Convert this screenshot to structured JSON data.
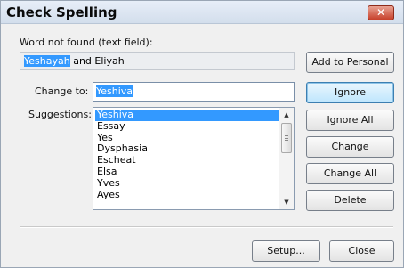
{
  "window": {
    "title": "Check Spelling",
    "close_glyph": "✕"
  },
  "not_found": {
    "label": "Word not found (text field):",
    "highlighted_word": "Yeshayah",
    "rest_text": " and Eliyah"
  },
  "change_to": {
    "label": "Change to:",
    "value": "Yeshiva"
  },
  "suggestions": {
    "label": "Suggestions:",
    "items": [
      "Yeshiva",
      "Essay",
      "Yes",
      "Dysphasia",
      "Escheat",
      "Elsa",
      "Yves",
      "Ayes"
    ],
    "selected_index": 0
  },
  "buttons": {
    "add_to_personal": "Add to Personal",
    "ignore": "Ignore",
    "ignore_all": "Ignore All",
    "change": "Change",
    "change_all": "Change All",
    "delete": "Delete",
    "setup": "Setup...",
    "close": "Close"
  },
  "colors": {
    "selection": "#3399ff",
    "default_button": "#bee6fd",
    "close_button": "#c7402a"
  }
}
